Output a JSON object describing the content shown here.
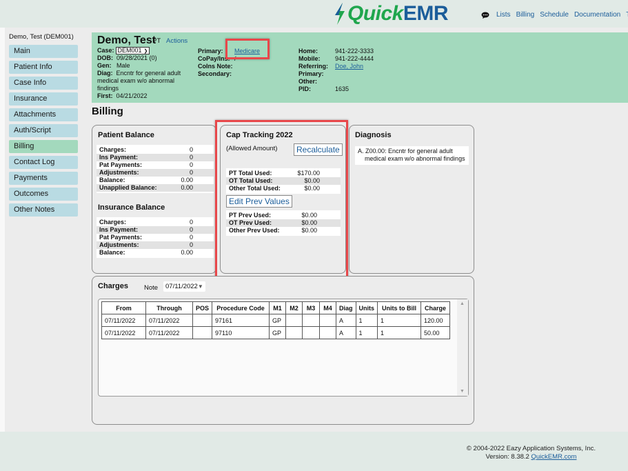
{
  "app": {
    "logo_quick": "Quick",
    "logo_emr": "EMR",
    "colors": {
      "brand_green": "#1fa64d",
      "brand_blue": "#1b5d9a",
      "header_bg": "#a3d9bd",
      "nav_bg": "#b9dbe3",
      "highlight": "#e8474a"
    }
  },
  "topnav": {
    "chat_icon": "chat-bubble-icon",
    "items": [
      "Lists",
      "Billing",
      "Schedule",
      "Documentation",
      "Te"
    ]
  },
  "sidebar": {
    "patient": "Demo, Test (DEM001)",
    "items": [
      {
        "label": "Main"
      },
      {
        "label": "Patient Info"
      },
      {
        "label": "Case Info"
      },
      {
        "label": "Insurance"
      },
      {
        "label": "Attachments"
      },
      {
        "label": "Auth/Script"
      },
      {
        "label": "Billing",
        "active": true
      },
      {
        "label": "Contact Log"
      },
      {
        "label": "Payments"
      },
      {
        "label": "Outcomes"
      },
      {
        "label": "Other Notes"
      }
    ]
  },
  "header": {
    "name": "Demo, Test",
    "type": "PT",
    "actions": "Actions",
    "case_label": "Case:",
    "case_value": "DEM001",
    "dob_label": "DOB:",
    "dob_value": "09/28/2021 (0)",
    "gen_label": "Gen:",
    "gen_value": "Male",
    "diag_label": "Diag:",
    "diag_value": "Encntr for general adult medical exam w/o abnormal findings",
    "first_label": "First:",
    "first_value": "04/21/2022",
    "primary_label": "Primary:",
    "primary_value": "Medicare",
    "copay_label": "CoPay/Ins:",
    "copay_value": "/",
    "coins_label": "CoIns Note:",
    "secondary_label": "Secondary:",
    "home_label": "Home:",
    "home_value": "941-222-3333",
    "mobile_label": "Mobile:",
    "mobile_value": "941-222-4444",
    "referring_label": "Referring:",
    "referring_value": "Doe, John",
    "primary2_label": "Primary:",
    "other_label": "Other:",
    "pid_label": "PID:",
    "pid_value": "1635"
  },
  "billing": {
    "title": "Billing",
    "patient_balance": {
      "title": "Patient Balance",
      "rows": [
        {
          "label": "Charges:",
          "value": "0"
        },
        {
          "label": "Ins Payment:",
          "value": "0"
        },
        {
          "label": "Pat Payments:",
          "value": "0"
        },
        {
          "label": "Adjustments:",
          "value": "0"
        },
        {
          "label": "Balance:",
          "value": "0.00"
        },
        {
          "label": "Unapplied Balance:",
          "value": "0.00"
        }
      ]
    },
    "insurance_balance": {
      "title": "Insurance Balance",
      "rows": [
        {
          "label": "Charges:",
          "value": "0"
        },
        {
          "label": "Ins Payment:",
          "value": "0"
        },
        {
          "label": "Pat Payments:",
          "value": "0"
        },
        {
          "label": "Adjustments:",
          "value": "0"
        },
        {
          "label": "Balance:",
          "value": "0.00"
        }
      ]
    },
    "cap_tracking": {
      "title": "Cap Tracking 2022",
      "subtitle": "(Allowed Amount)",
      "recalculate": "Recalculate",
      "edit_prev": "Edit Prev Values",
      "totals": [
        {
          "label": "PT Total Used:",
          "value": "$170.00"
        },
        {
          "label": "OT Total Used:",
          "value": "$0.00"
        },
        {
          "label": "Other Total Used:",
          "value": "$0.00"
        }
      ],
      "prev": [
        {
          "label": "PT Prev Used:",
          "value": "$0.00"
        },
        {
          "label": "OT Prev Used:",
          "value": "$0.00"
        },
        {
          "label": "Other Prev Used:",
          "value": "$0.00"
        }
      ]
    },
    "diagnosis": {
      "title": "Diagnosis",
      "items": [
        "A. Z00.00: Encntr for general adult medical exam w/o abnormal findings"
      ]
    },
    "charges": {
      "title": "Charges",
      "note_label": "Note",
      "note_value": "07/11/2022",
      "columns": [
        "From",
        "Through",
        "POS",
        "Procedure Code",
        "M1",
        "M2",
        "M3",
        "M4",
        "Diag",
        "Units",
        "Units to Bill",
        "Charge"
      ],
      "rows": [
        [
          "07/11/2022",
          "07/11/2022",
          "",
          "97161",
          "GP",
          "",
          "",
          "",
          "A",
          "1",
          "1",
          "120.00"
        ],
        [
          "07/11/2022",
          "07/11/2022",
          "",
          "97110",
          "GP",
          "",
          "",
          "",
          "A",
          "1",
          "1",
          "50.00"
        ]
      ]
    }
  },
  "footer": {
    "copyright": "© 2004-2022 Eazy Application Systems, Inc.",
    "version": "Version: 8.38.2",
    "link": "QuickEMR.com"
  }
}
